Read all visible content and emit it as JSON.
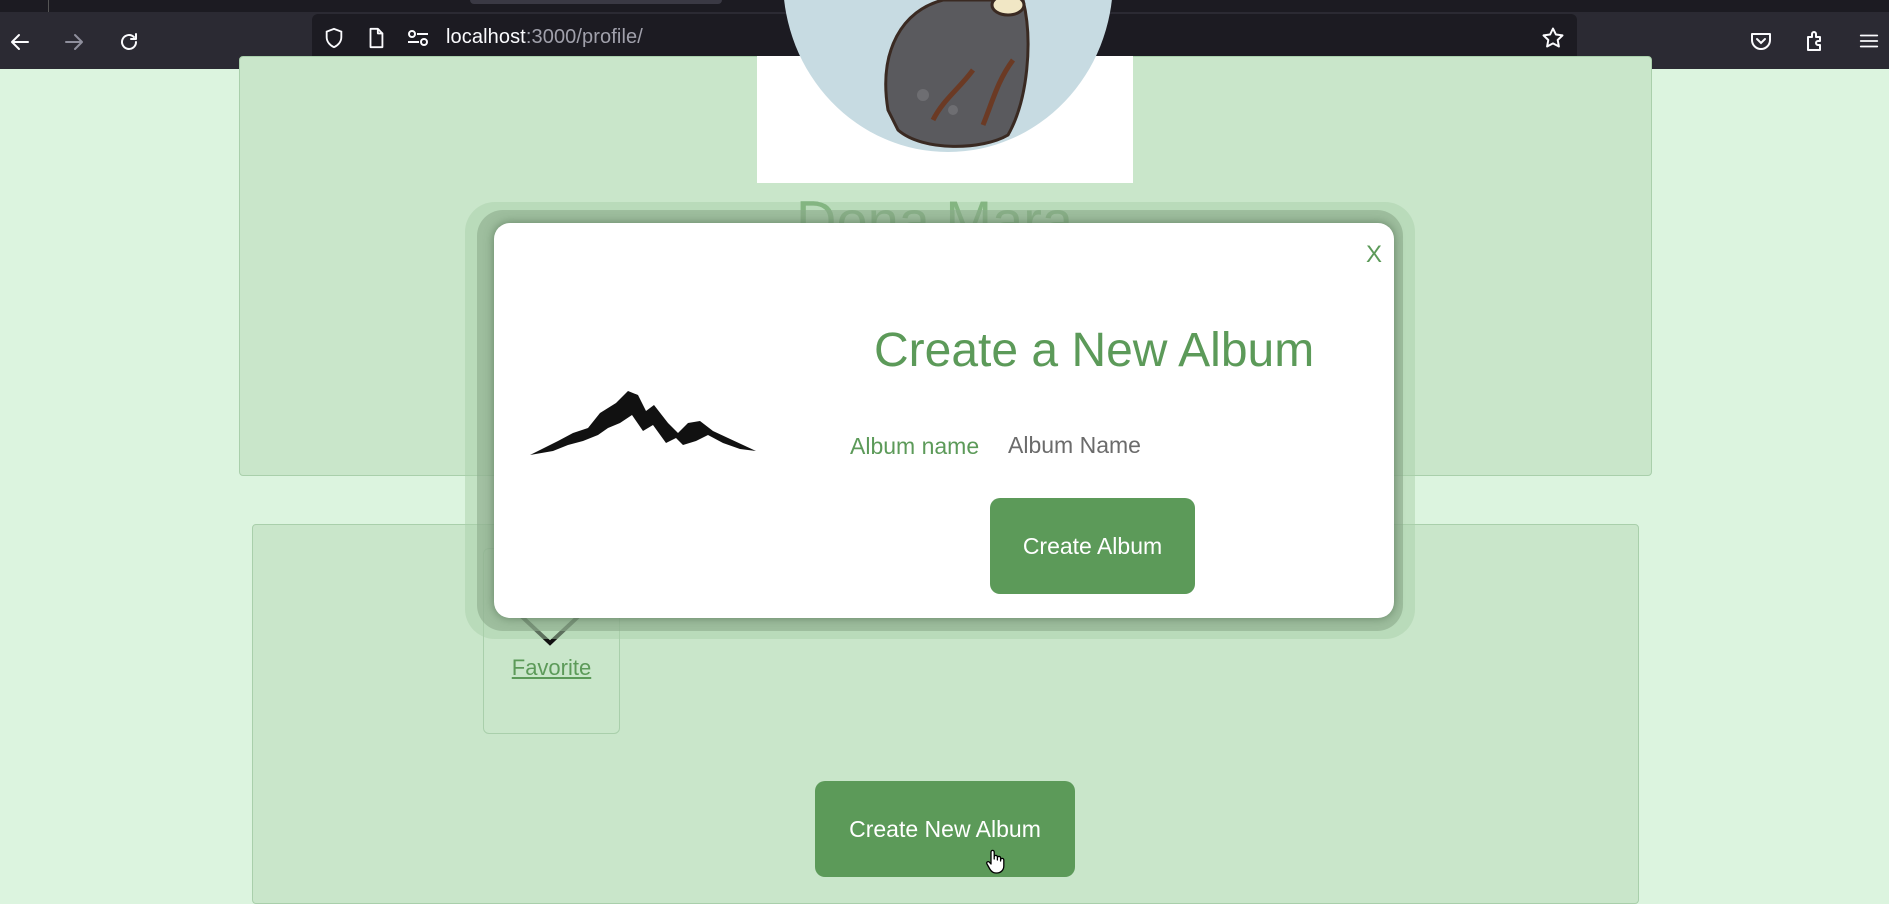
{
  "browser": {
    "url_host": "localhost",
    "url_path": ":3000/profile/"
  },
  "profile": {
    "name": "Dona Mara"
  },
  "favorite": {
    "label": "Favorite"
  },
  "page_actions": {
    "create_new_album": "Create New Album"
  },
  "modal": {
    "close_label": "X",
    "title": "Create a New Album",
    "field_label": "Album name",
    "field_placeholder": "Album Name",
    "submit_label": "Create Album"
  },
  "colors": {
    "accent": "#5c9a59",
    "page_bg": "#dcf4df",
    "panel_bg": "#c9e6ca"
  }
}
